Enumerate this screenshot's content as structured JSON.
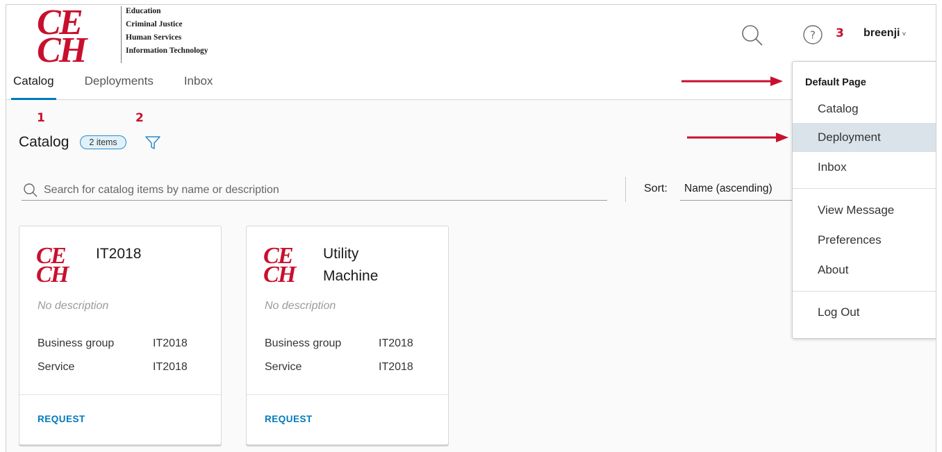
{
  "header": {
    "logo_letters": "CE CH",
    "org_lines": [
      "Education",
      "Criminal Justice",
      "Human Services",
      "Information Technology"
    ],
    "search_icon": "search-icon",
    "help_icon": "help-circle-icon",
    "user_name": "breenji",
    "user_chevron": "˅"
  },
  "annotations": {
    "one": "1",
    "two": "2",
    "three": "3"
  },
  "colors": {
    "accent": "#0079b8",
    "annotation_red": "#c8102e",
    "logo_red": "#c8102e",
    "selected_bg": "#dae3ea"
  },
  "tabs": [
    {
      "label": "Catalog",
      "active": true
    },
    {
      "label": "Deployments",
      "active": false
    },
    {
      "label": "Inbox",
      "active": false
    }
  ],
  "catalog": {
    "title": "Catalog",
    "count_badge": "2 items",
    "filter_icon": "filter-icon",
    "search_placeholder": "Search for catalog items by name or description",
    "sort_label": "Sort:",
    "sort_value": "Name (ascending)"
  },
  "cards": [
    {
      "title": "IT2018",
      "description": "No description",
      "business_group_label": "Business group",
      "business_group": "IT2018",
      "service_label": "Service",
      "service": "IT2018",
      "action": "REQUEST"
    },
    {
      "title": "Utility Machine",
      "description": "No description",
      "business_group_label": "Business group",
      "business_group": "IT2018",
      "service_label": "Service",
      "service": "IT2018",
      "action": "REQUEST"
    }
  ],
  "user_dropdown": {
    "header": "Default Page",
    "items": [
      {
        "label": "Catalog",
        "selected": false
      },
      {
        "label": "Deployment",
        "selected": true
      },
      {
        "label": "Inbox",
        "selected": false
      },
      {
        "label": "View Message",
        "selected": false
      },
      {
        "label": "Preferences",
        "selected": false
      },
      {
        "label": "About",
        "selected": false
      },
      {
        "label": "Log Out",
        "selected": false
      }
    ]
  }
}
